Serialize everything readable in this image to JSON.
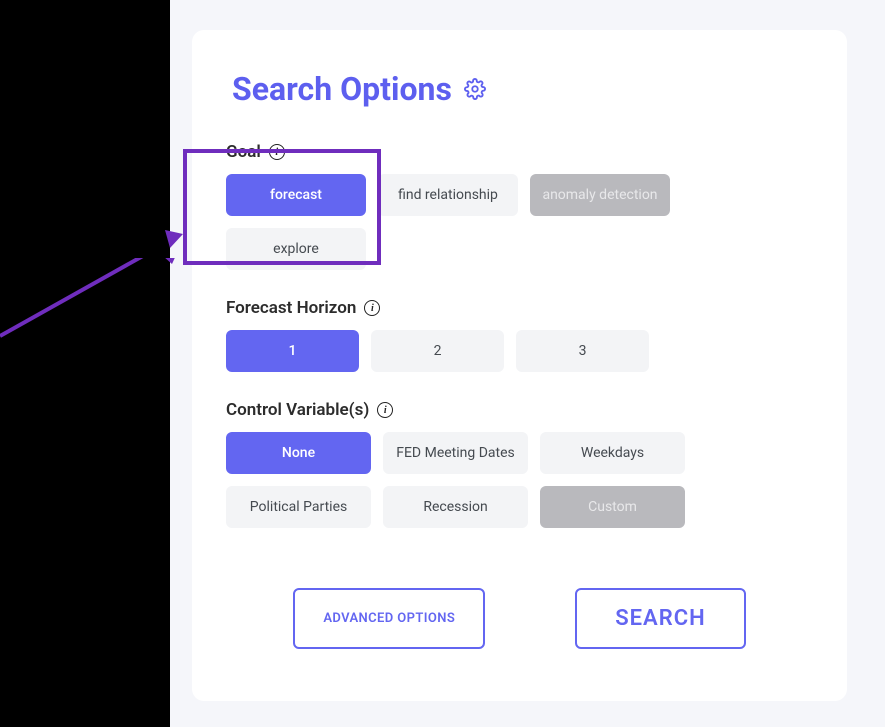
{
  "title": "Search Options",
  "sections": {
    "goal": {
      "label": "Goal",
      "options": [
        {
          "label": "forecast",
          "state": "selected"
        },
        {
          "label": "find relationship",
          "state": "normal"
        },
        {
          "label": "anomaly detection",
          "state": "disabled"
        },
        {
          "label": "explore",
          "state": "normal"
        }
      ]
    },
    "horizon": {
      "label": "Forecast Horizon",
      "options": [
        {
          "label": "1",
          "state": "selected"
        },
        {
          "label": "2",
          "state": "normal"
        },
        {
          "label": "3",
          "state": "normal"
        }
      ]
    },
    "control": {
      "label": "Control Variable(s)",
      "options": [
        {
          "label": "None",
          "state": "selected"
        },
        {
          "label": "FED Meeting Dates",
          "state": "normal"
        },
        {
          "label": "Weekdays",
          "state": "normal"
        },
        {
          "label": "Political Parties",
          "state": "normal"
        },
        {
          "label": "Recession",
          "state": "normal"
        },
        {
          "label": "Custom",
          "state": "disabled"
        }
      ]
    }
  },
  "actions": {
    "advanced": "ADVANCED OPTIONS",
    "search": "SEARCH"
  }
}
